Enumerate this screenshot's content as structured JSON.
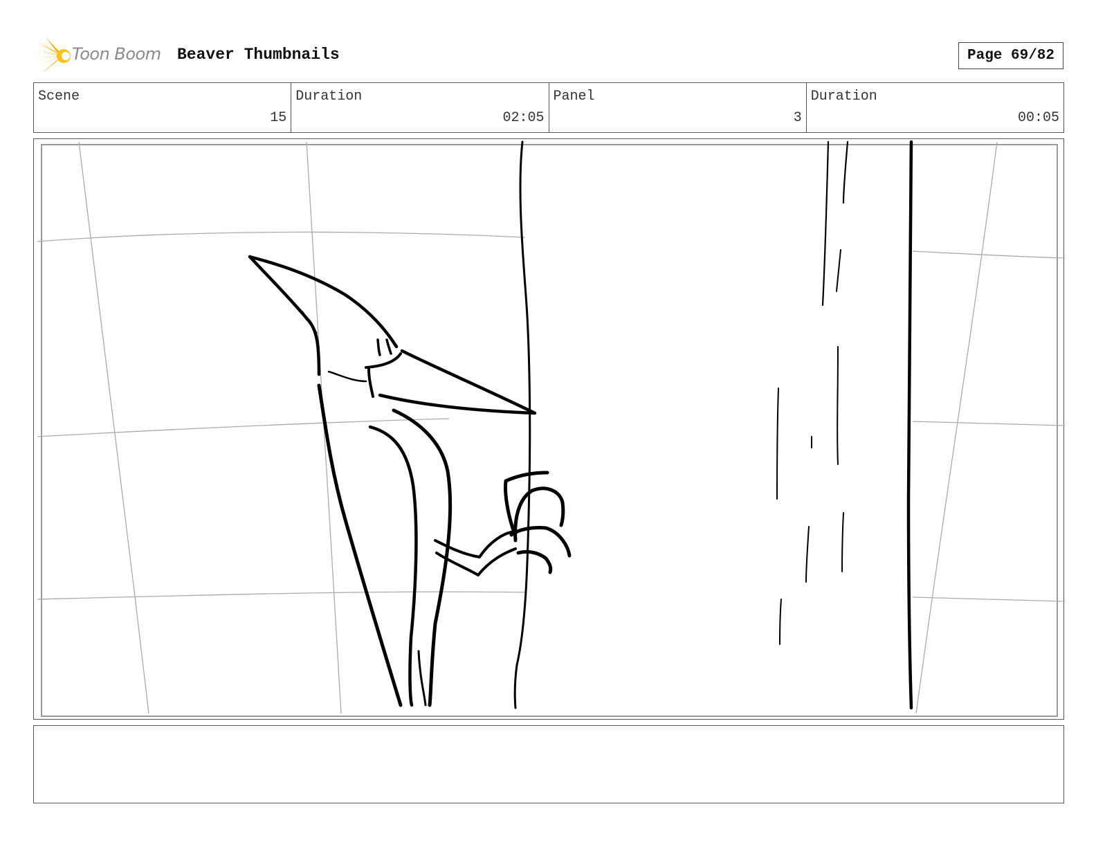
{
  "header": {
    "logo_text": "Toon Boom",
    "project_title": "Beaver Thumbnails",
    "page_label": "Page 69/82"
  },
  "info": {
    "scene_label": "Scene",
    "scene_value": "15",
    "scene_duration_label": "Duration",
    "scene_duration_value": "02:05",
    "panel_label": "Panel",
    "panel_value": "3",
    "panel_duration_label": "Duration",
    "panel_duration_value": "00:05"
  },
  "drawing": {
    "subject": "woodpecker on tree trunk sketch"
  },
  "notes": {
    "text": ""
  }
}
